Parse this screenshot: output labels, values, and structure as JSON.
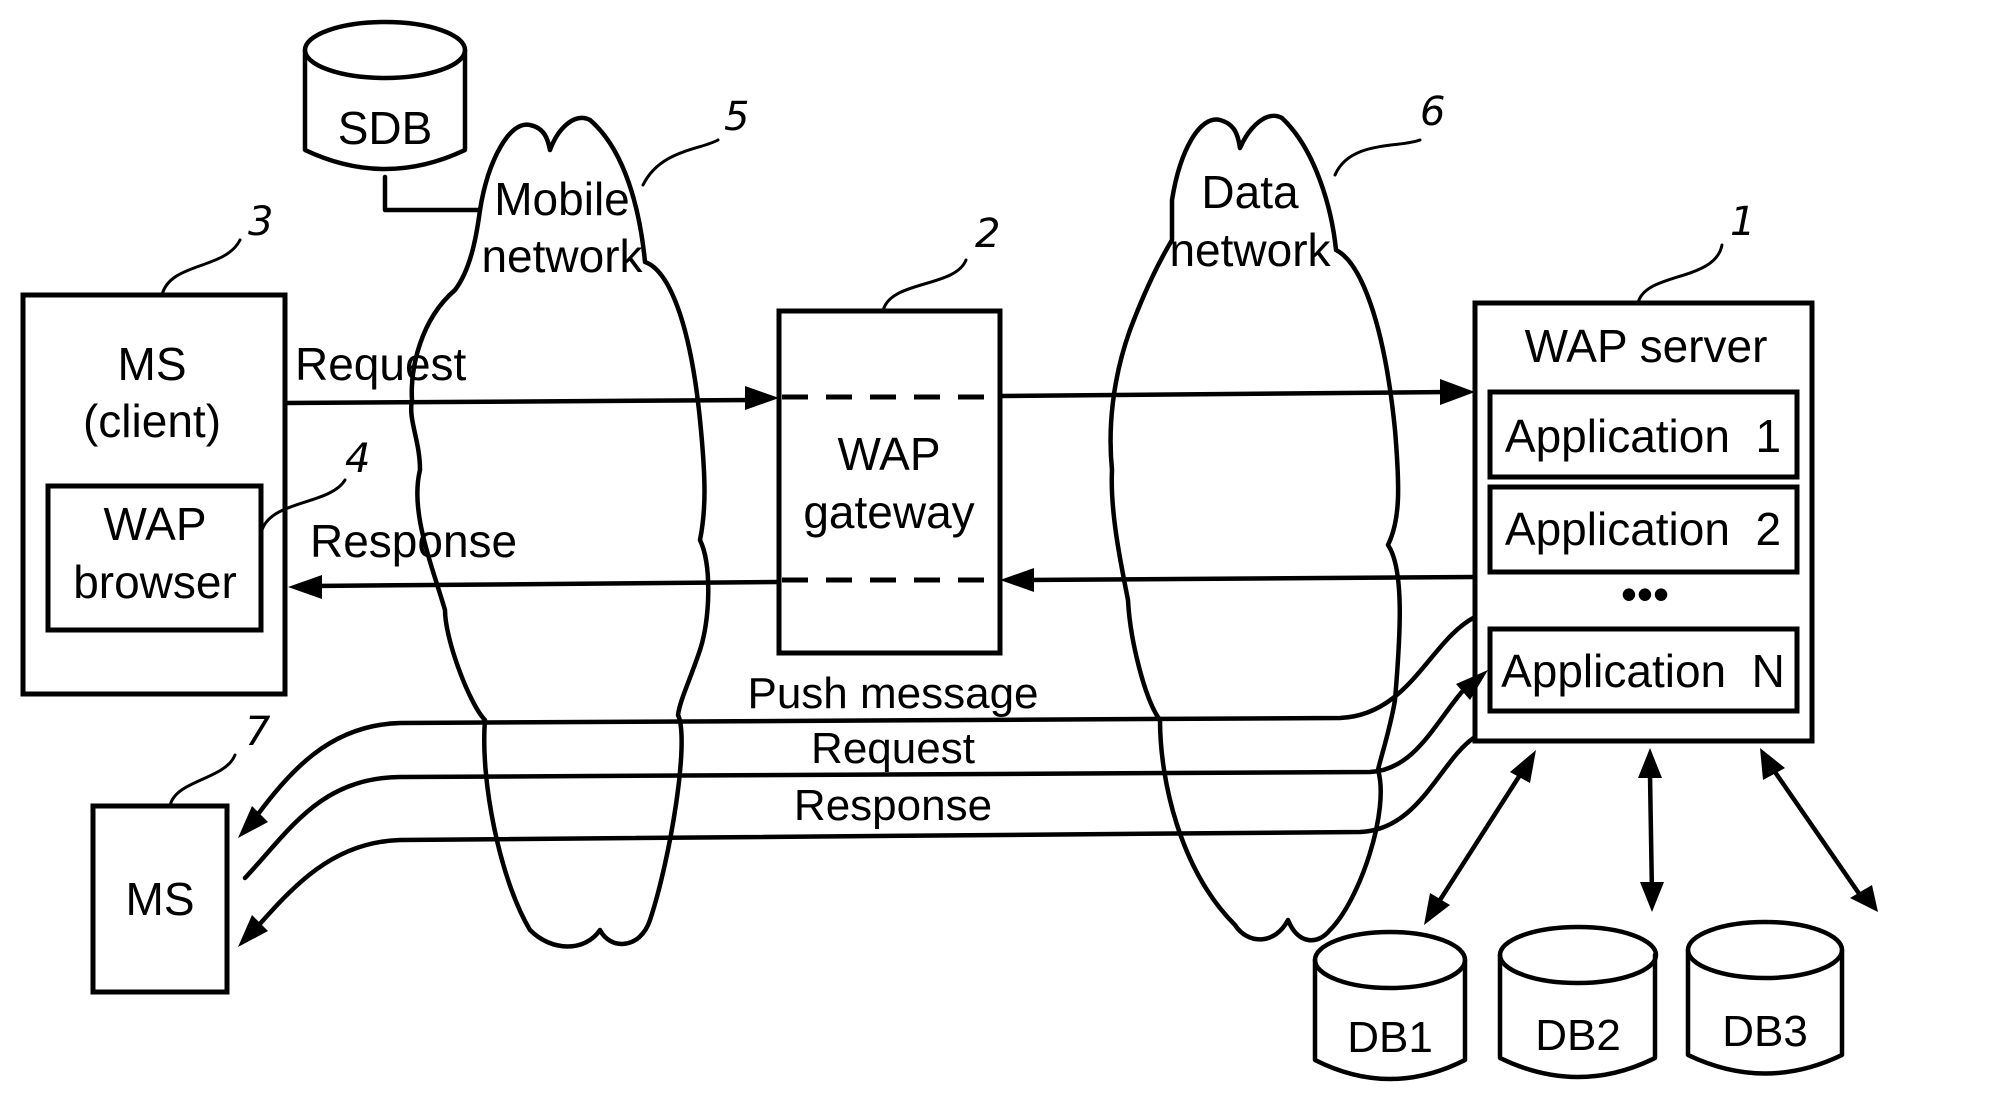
{
  "diagram": {
    "nodes": {
      "sdb": {
        "label": "SDB"
      },
      "mobile_network": {
        "line1": "Mobile",
        "line2": "network",
        "ref": "5"
      },
      "data_network": {
        "line1": "Data",
        "line2": "network",
        "ref": "6"
      },
      "ms_client": {
        "line1": "MS",
        "line2": "(client)",
        "ref": "3"
      },
      "wap_browser": {
        "line1": "WAP",
        "line2": "browser",
        "ref": "4"
      },
      "wap_gateway": {
        "line1": "WAP",
        "line2": "gateway",
        "ref": "2"
      },
      "wap_server": {
        "title": "WAP server",
        "ref": "1",
        "applications": [
          "Application  1",
          "Application  2",
          "Application  N"
        ],
        "ellipsis": "•••"
      },
      "ms_push": {
        "label": "MS",
        "ref": "7"
      },
      "databases": [
        "DB1",
        "DB2",
        "DB3"
      ]
    },
    "edges": {
      "request": "Request",
      "response": "Response",
      "push_message": "Push message",
      "push_request": "Request",
      "push_response": "Response"
    }
  }
}
